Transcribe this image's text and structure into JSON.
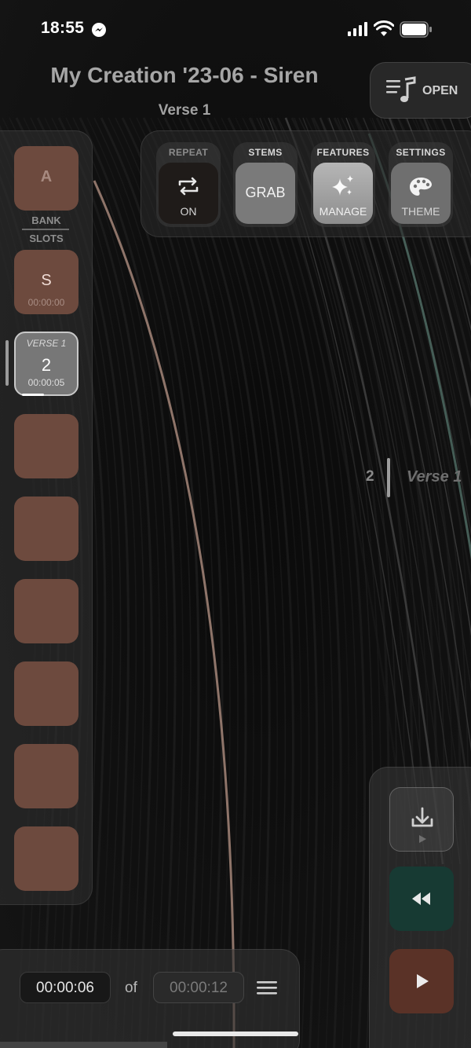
{
  "status_bar": {
    "time": "18:55",
    "icons": [
      "messenger-icon",
      "signal-icon",
      "wifi-icon",
      "battery-icon"
    ]
  },
  "header": {
    "title": "My Creation '23-06 - Siren",
    "subtitle": "Verse 1",
    "open_button": {
      "label": "OPEN",
      "icon": "music-list-icon"
    }
  },
  "controls": {
    "repeat": {
      "header": "REPEAT",
      "value": "ON",
      "icon": "repeat-icon"
    },
    "stems": {
      "header": "STEMS",
      "value": "GRAB"
    },
    "features": {
      "header": "FEATURES",
      "value": "MANAGE",
      "icon": "sparkles-icon"
    },
    "settings": {
      "header": "SETTINGS",
      "value": "THEME",
      "icon": "palette-icon"
    }
  },
  "sidebar": {
    "bank_button": "A",
    "bank_label": "BANK",
    "slots_label": "SLOTS",
    "slot_s": {
      "label": "S",
      "time": "00:00:00"
    },
    "slot_active": {
      "section": "VERSE 1",
      "number": "2",
      "time": "00:00:05"
    },
    "empty_slot_count": 6
  },
  "waveform": {
    "marker_number": "2",
    "marker_label": "Verse 1"
  },
  "transport": {
    "buttons": [
      "download-icon",
      "rewind-icon",
      "play-icon"
    ]
  },
  "time": {
    "current": "00:00:06",
    "separator": "of",
    "total": "00:00:12"
  },
  "colors": {
    "slot_brown": "#6d4a3e",
    "rewind_green": "#173a33",
    "play_brown": "#5a3227",
    "background": "#0b0b0b"
  }
}
